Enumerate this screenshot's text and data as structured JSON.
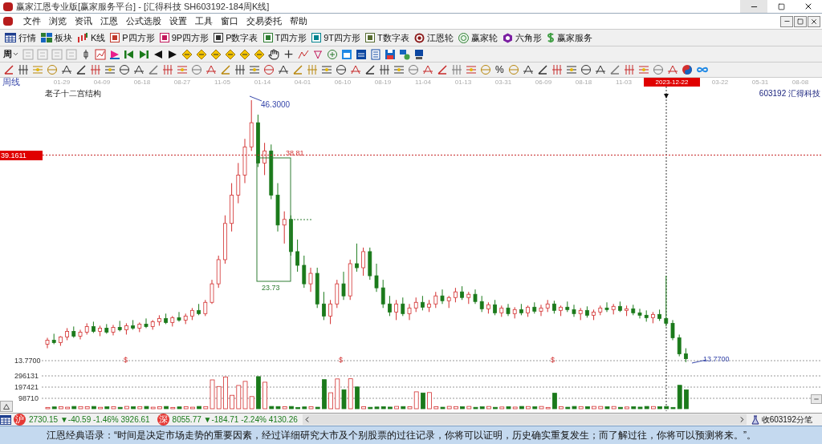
{
  "window": {
    "title": "赢家江恩专业版[赢家服务平台] - [汇得科技  SH603192-184周K线]"
  },
  "menu": [
    "文件",
    "浏览",
    "资讯",
    "江恩",
    "公式选股",
    "设置",
    "工具",
    "窗口",
    "交易委托",
    "帮助"
  ],
  "main_toolbar": [
    {
      "label": "行情",
      "kind": "table"
    },
    {
      "label": "板块",
      "kind": "blocks"
    },
    {
      "label": "K线",
      "kind": "candles"
    },
    {
      "label": "P四方形",
      "kind": "badge-red"
    },
    {
      "label": "9P四方形",
      "kind": "badge-pink"
    },
    {
      "label": "P数字表",
      "kind": "badge-dark"
    },
    {
      "label": "T四方形",
      "kind": "badge-green"
    },
    {
      "label": "9T四方形",
      "kind": "badge-teal"
    },
    {
      "label": "T数字表",
      "kind": "badge-olive"
    },
    {
      "label": "江恩轮",
      "kind": "wheel"
    },
    {
      "label": "赢家轮",
      "kind": "coin"
    },
    {
      "label": "六角形",
      "kind": "hexagon"
    },
    {
      "label": "赢家服务",
      "kind": "dollar"
    }
  ],
  "toolbar_2": {
    "period": "周"
  },
  "toolbar_3": {
    "percent": "%"
  },
  "date_axis": {
    "period_label": "周线",
    "dates": [
      {
        "label": "01-29",
        "selected": false
      },
      {
        "label": "04-09",
        "selected": false
      },
      {
        "label": "06-18",
        "selected": false
      },
      {
        "label": "08-27",
        "selected": false
      },
      {
        "label": "11-05",
        "selected": false
      },
      {
        "label": "01-14",
        "selected": false
      },
      {
        "label": "04-01",
        "selected": false
      },
      {
        "label": "06-10",
        "selected": false
      },
      {
        "label": "08-19",
        "selected": false
      },
      {
        "label": "11-04",
        "selected": false
      },
      {
        "label": "01-13",
        "selected": false
      },
      {
        "label": "03-31",
        "selected": false
      },
      {
        "label": "06-09",
        "selected": false
      },
      {
        "label": "08-18",
        "selected": false
      },
      {
        "label": "11-03",
        "selected": false
      },
      {
        "label": "2023-12-22",
        "selected": true
      },
      {
        "label": "03-22",
        "selected": false
      },
      {
        "label": "05-31",
        "selected": false
      },
      {
        "label": "08-08",
        "selected": false
      }
    ]
  },
  "chart": {
    "chart_data": {
      "type": "candlestick",
      "ohlc": [
        [
          16.0,
          16.8,
          15.5,
          16.5
        ],
        [
          16.5,
          17.3,
          16.0,
          16.2
        ],
        [
          16.2,
          17.0,
          15.8,
          16.9
        ],
        [
          16.9,
          18.0,
          16.5,
          17.6
        ],
        [
          17.6,
          18.2,
          16.8,
          17.0
        ],
        [
          17.0,
          17.8,
          16.6,
          17.5
        ],
        [
          17.5,
          18.6,
          17.2,
          18.2
        ],
        [
          18.2,
          18.8,
          17.4,
          17.6
        ],
        [
          17.6,
          18.3,
          17.0,
          18.0
        ],
        [
          18.0,
          18.5,
          17.3,
          17.5
        ],
        [
          17.5,
          18.4,
          17.1,
          18.1
        ],
        [
          18.1,
          18.9,
          17.6,
          17.8
        ],
        [
          17.8,
          18.6,
          17.2,
          18.3
        ],
        [
          18.3,
          19.0,
          17.8,
          18.0
        ],
        [
          18.0,
          18.7,
          17.5,
          18.5
        ],
        [
          18.5,
          19.2,
          18.0,
          18.2
        ],
        [
          18.2,
          19.0,
          17.8,
          18.8
        ],
        [
          18.8,
          19.6,
          18.3,
          19.2
        ],
        [
          19.2,
          19.8,
          18.5,
          18.7
        ],
        [
          18.7,
          19.5,
          18.2,
          19.3
        ],
        [
          19.3,
          20.0,
          18.8,
          19.0
        ],
        [
          19.0,
          19.8,
          18.5,
          19.5
        ],
        [
          19.5,
          20.5,
          19.0,
          20.2
        ],
        [
          20.2,
          21.0,
          19.6,
          19.8
        ],
        [
          19.8,
          21.5,
          19.5,
          21.2
        ],
        [
          21.2,
          24.0,
          21.0,
          23.5
        ],
        [
          23.5,
          27.0,
          23.0,
          26.5
        ],
        [
          26.5,
          32.0,
          26.0,
          31.0
        ],
        [
          31.0,
          36.0,
          30.0,
          34.5
        ],
        [
          34.5,
          38.5,
          33.5,
          37.0
        ],
        [
          37.0,
          41.5,
          36.0,
          40.5
        ],
        [
          40.5,
          46.3,
          40.0,
          43.5
        ],
        [
          43.5,
          44.5,
          38.0,
          38.5
        ],
        [
          38.5,
          41.0,
          37.0,
          40.0
        ],
        [
          40.0,
          40.8,
          34.0,
          34.5
        ],
        [
          34.5,
          36.0,
          30.0,
          30.8
        ],
        [
          30.8,
          32.5,
          28.5,
          31.5
        ],
        [
          31.5,
          32.0,
          27.0,
          27.5
        ],
        [
          27.5,
          29.0,
          25.0,
          25.8
        ],
        [
          25.8,
          27.0,
          23.0,
          23.5
        ],
        [
          23.5,
          25.5,
          22.5,
          24.8
        ],
        [
          24.8,
          25.5,
          20.5,
          21.0
        ],
        [
          21.0,
          22.5,
          19.0,
          19.5
        ],
        [
          19.5,
          21.5,
          18.5,
          21.0
        ],
        [
          21.0,
          24.0,
          20.5,
          23.5
        ],
        [
          23.5,
          25.0,
          21.5,
          22.0
        ],
        [
          22.0,
          26.5,
          21.5,
          26.0
        ],
        [
          26.0,
          28.5,
          25.0,
          25.5
        ],
        [
          25.5,
          28.0,
          24.5,
          27.5
        ],
        [
          27.5,
          28.0,
          24.0,
          24.5
        ],
        [
          24.5,
          26.0,
          22.5,
          23.0
        ],
        [
          23.0,
          24.0,
          20.5,
          21.0
        ],
        [
          21.0,
          22.0,
          19.5,
          20.0
        ],
        [
          20.0,
          21.5,
          19.0,
          21.0
        ],
        [
          21.0,
          21.8,
          19.5,
          19.8
        ],
        [
          19.8,
          21.0,
          19.0,
          20.5
        ],
        [
          20.5,
          21.8,
          20.0,
          21.2
        ],
        [
          21.2,
          22.0,
          20.2,
          20.6
        ],
        [
          20.6,
          21.5,
          20.0,
          21.0
        ],
        [
          21.0,
          22.5,
          20.5,
          22.0
        ],
        [
          22.0,
          22.8,
          21.0,
          21.4
        ],
        [
          21.4,
          22.0,
          20.5,
          21.8
        ],
        [
          21.8,
          23.0,
          21.2,
          22.5
        ],
        [
          22.5,
          23.2,
          21.5,
          21.8
        ],
        [
          21.8,
          22.5,
          21.0,
          22.2
        ],
        [
          22.2,
          22.8,
          21.0,
          21.3
        ],
        [
          21.3,
          22.0,
          20.0,
          20.4
        ],
        [
          20.4,
          21.2,
          19.8,
          20.9
        ],
        [
          20.9,
          21.5,
          19.6,
          19.9
        ],
        [
          19.9,
          20.8,
          19.4,
          20.5
        ],
        [
          20.5,
          21.0,
          19.5,
          19.8
        ],
        [
          19.8,
          20.6,
          19.2,
          20.3
        ],
        [
          20.3,
          21.0,
          19.6,
          19.9
        ],
        [
          19.9,
          20.8,
          19.4,
          20.6
        ],
        [
          20.6,
          21.2,
          19.8,
          20.1
        ],
        [
          20.1,
          20.9,
          19.5,
          20.5
        ],
        [
          20.5,
          21.5,
          20.0,
          21.0
        ],
        [
          21.0,
          21.4,
          19.8,
          20.2
        ],
        [
          20.2,
          20.8,
          19.5,
          20.6
        ],
        [
          20.6,
          21.3,
          20.0,
          20.3
        ],
        [
          20.3,
          20.9,
          19.4,
          19.8
        ],
        [
          19.8,
          20.5,
          19.0,
          20.2
        ],
        [
          20.2,
          20.7,
          19.3,
          19.6
        ],
        [
          19.6,
          20.3,
          19.0,
          20.0
        ],
        [
          20.0,
          20.8,
          19.6,
          20.5
        ],
        [
          20.5,
          21.2,
          20.0,
          20.3
        ],
        [
          20.3,
          21.0,
          19.7,
          20.7
        ],
        [
          20.7,
          21.3,
          20.0,
          20.2
        ],
        [
          20.2,
          20.8,
          19.5,
          20.4
        ],
        [
          20.4,
          20.9,
          19.6,
          19.9
        ],
        [
          19.9,
          20.4,
          19.2,
          19.6
        ],
        [
          19.6,
          20.2,
          18.8,
          19.3
        ],
        [
          19.3,
          20.0,
          18.6,
          19.7
        ],
        [
          19.7,
          20.3,
          18.9,
          19.2
        ],
        [
          19.2,
          24.5,
          18.2,
          18.6
        ],
        [
          18.6,
          19.0,
          16.5,
          16.8
        ],
        [
          16.8,
          17.2,
          14.5,
          14.8
        ],
        [
          14.8,
          15.5,
          13.77,
          14.2
        ]
      ]
    },
    "title": "老子十二宫结构",
    "stock": "603192 汇得科技",
    "high_label": "46.3000",
    "box_top_label": "38.81",
    "box_bottom_label": "23.73",
    "low_label": "13.7700",
    "cursor_price": "39.1611",
    "axis_low": "13.7700",
    "volume_ticks": [
      "296131",
      "197421",
      "98710"
    ],
    "signal_marks": [
      "$",
      "$",
      "$"
    ]
  },
  "status_bar": {
    "indices": [
      {
        "market": "沪",
        "value": "2730.15",
        "change": "▼-40.59",
        "percent": "-1.46%",
        "amount": "3926.61"
      },
      {
        "market": "深",
        "value": "8055.77",
        "change": "▼-184.71",
        "percent": "-2.24%",
        "amount": "4130.26"
      }
    ],
    "stream_label": "收603192分笔"
  },
  "ticker": "江恩经典语录：“时间是决定市场走势的重要因素，经过详细研究大市及个别股票的过往记录，你将可以证明，历史确实重复发生；而了解过往，你将可以预测将来。”。"
}
